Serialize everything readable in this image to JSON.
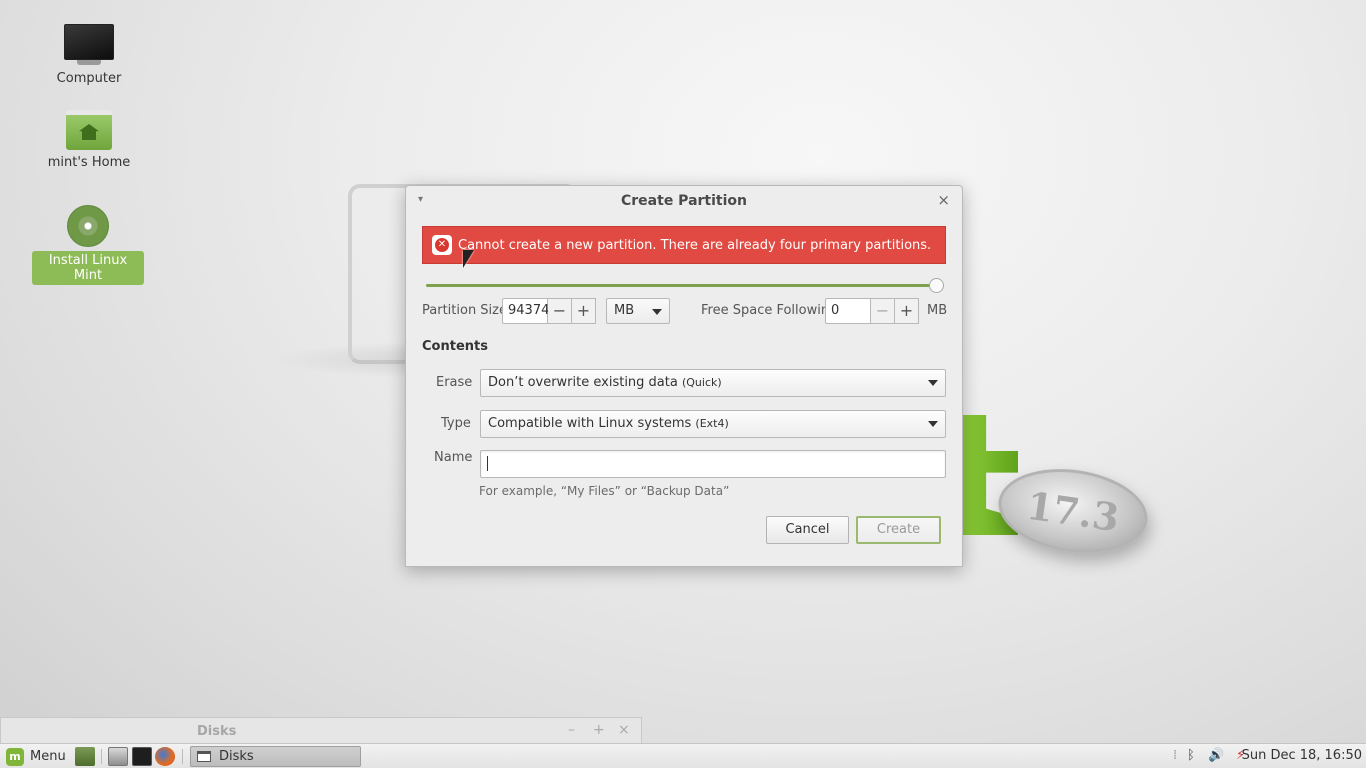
{
  "desktop": {
    "icons": [
      {
        "label": "Computer",
        "icon": "computer-icon"
      },
      {
        "label": "mint's Home",
        "icon": "home-folder-icon"
      },
      {
        "label": "Install Linux Mint",
        "icon": "disc-icon"
      }
    ]
  },
  "wallpaper": {
    "badge_text": "17.3"
  },
  "dialog": {
    "title": "Create Partition",
    "close_glyph": "×",
    "menu_glyph": "▾",
    "error": {
      "message": "Cannot create a new partition. There are already four primary partitions.",
      "icon": "error-icon",
      "color": "#e14a42"
    },
    "slider": {
      "value_fraction": 1.0
    },
    "partition_size": {
      "label": "Partition Size",
      "value": "94374",
      "minus": "−",
      "plus": "+",
      "unit": "MB"
    },
    "free_space": {
      "label": "Free Space Following",
      "value": "0",
      "minus": "−",
      "plus": "+",
      "unit": "MB"
    },
    "contents_heading": "Contents",
    "erase": {
      "label": "Erase",
      "value": "Don’t overwrite existing data",
      "hint": "(Quick)"
    },
    "type": {
      "label": "Type",
      "value": "Compatible with Linux systems",
      "hint": "(Ext4)"
    },
    "name": {
      "label": "Name",
      "value": "",
      "example": "For example, “My Files” or “Backup Data”"
    },
    "buttons": {
      "cancel": "Cancel",
      "create": "Create"
    }
  },
  "disks_window": {
    "title": "Disks",
    "minimize": "–",
    "maximize": "+",
    "close": "×"
  },
  "taskbar": {
    "menu_label": "Menu",
    "logo_text": "m",
    "task_label": "Disks",
    "tray_bluetooth": "ᛒ",
    "tray_volume": "🔊",
    "tray_network": "⚡",
    "tray_handle": "⁞",
    "clock": "Sun Dec 18, 16:50",
    "accent": "#7fb539"
  }
}
